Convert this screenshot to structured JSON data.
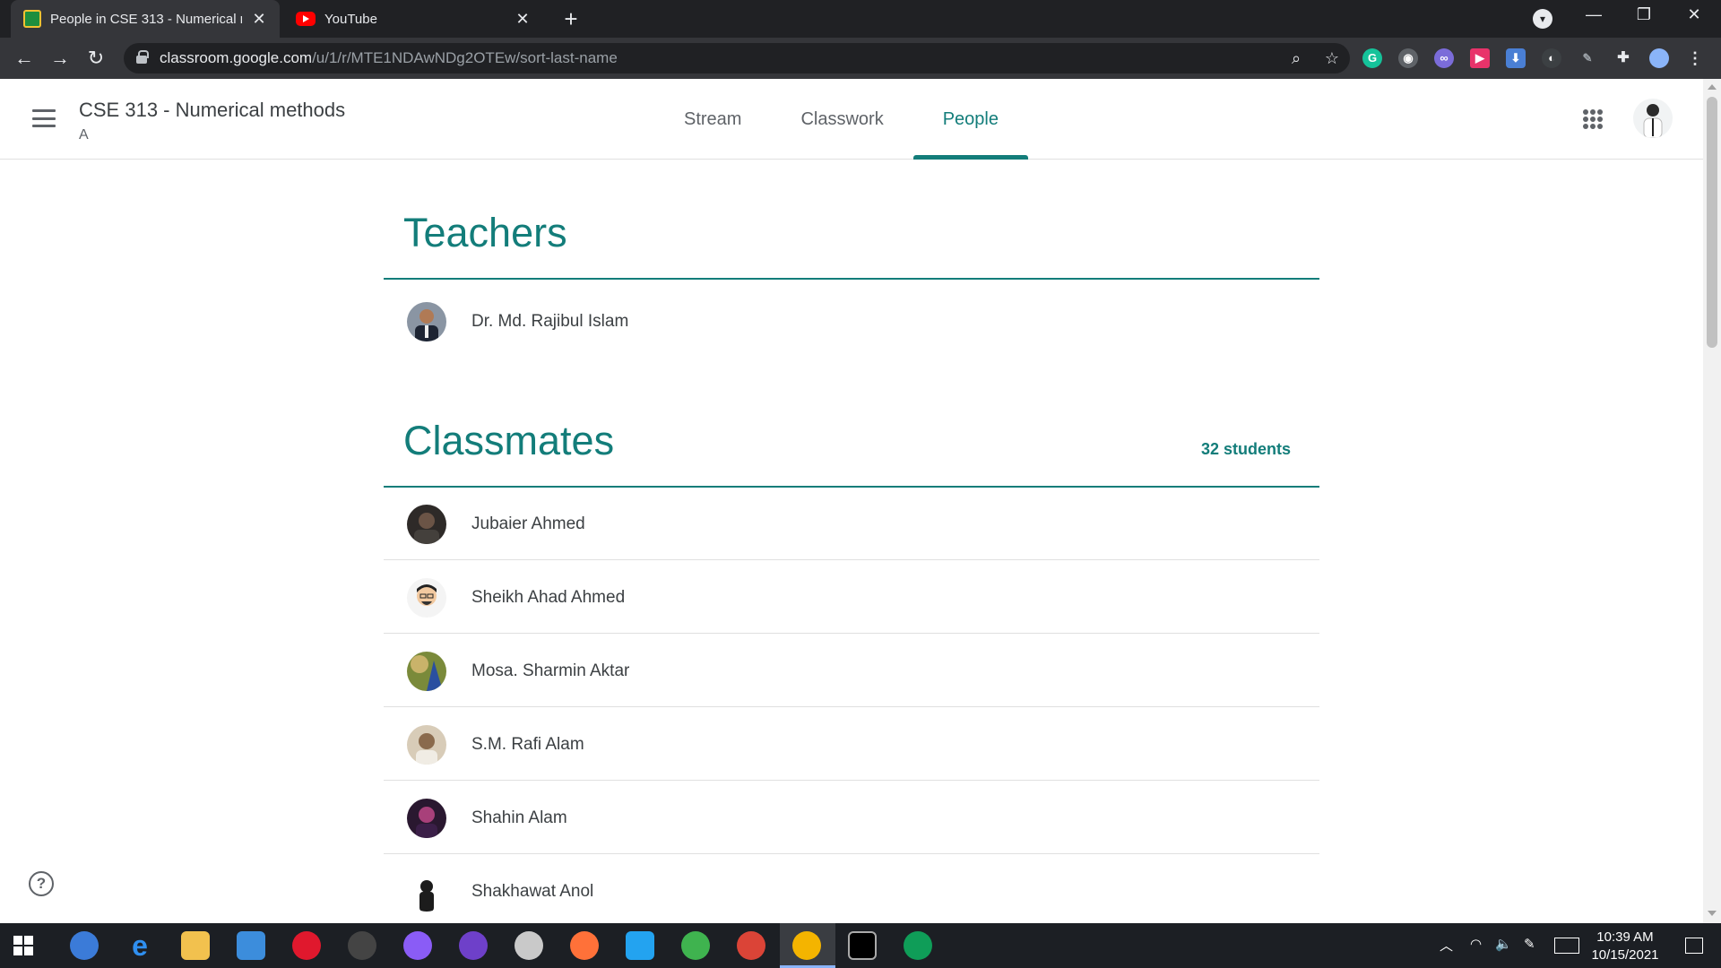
{
  "browser": {
    "tabs": [
      {
        "title": "People in CSE 313 - Numerical m",
        "active": true
      },
      {
        "title": "YouTube",
        "active": false
      }
    ],
    "url_host": "classroom.google.com",
    "url_path": "/u/1/r/MTE1NDAwNDg2OTEw/sort-last-name"
  },
  "course": {
    "title": "CSE 313 - Numerical methods",
    "section": "A"
  },
  "nav": {
    "tabs": [
      "Stream",
      "Classwork",
      "People"
    ],
    "active": "People"
  },
  "teachers": {
    "heading": "Teachers",
    "list": [
      {
        "name": "Dr. Md. Rajibul Islam"
      }
    ]
  },
  "classmates": {
    "heading": "Classmates",
    "count": "32 students",
    "list": [
      {
        "name": "Jubaier Ahmed"
      },
      {
        "name": "Sheikh Ahad Ahmed"
      },
      {
        "name": "Mosa. Sharmin Aktar"
      },
      {
        "name": "S.M. Rafi Alam"
      },
      {
        "name": "Shahin Alam"
      },
      {
        "name": "Shakhawat Anol"
      }
    ]
  },
  "taskbar": {
    "time": "10:39 AM",
    "date": "10/15/2021"
  },
  "colors": {
    "accent": "#137d7a",
    "chrome_dark": "#202124",
    "chrome_toolbar": "#35363a"
  }
}
